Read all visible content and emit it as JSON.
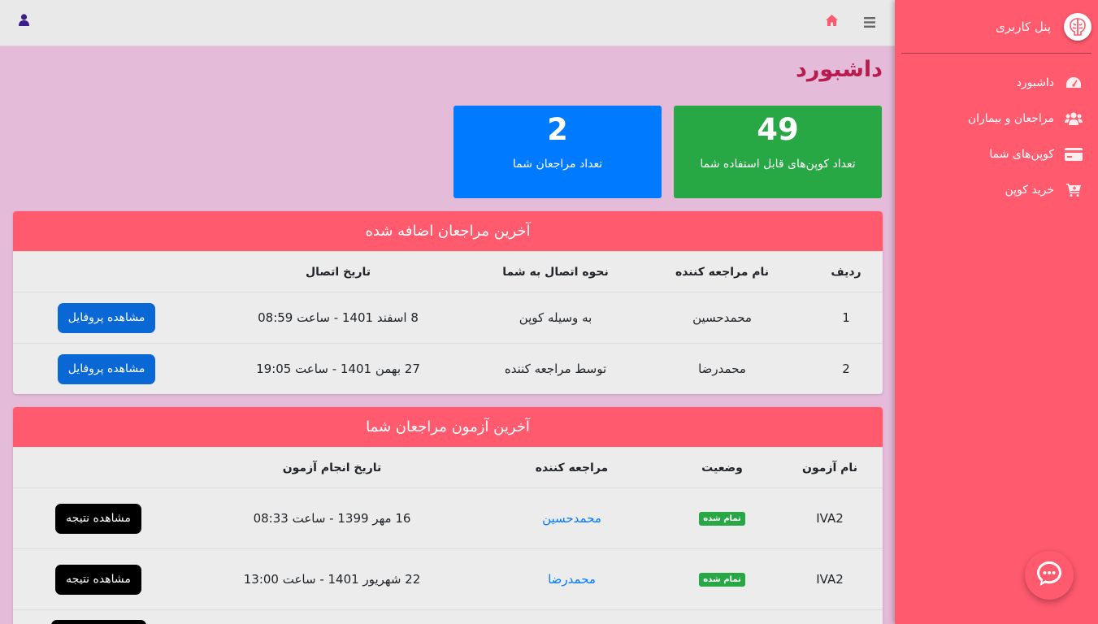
{
  "sidebar": {
    "title": "پنل کاربری",
    "items": [
      {
        "label": "داشبورد",
        "icon": "tachometer-icon"
      },
      {
        "label": "مراجعان و بیماران",
        "icon": "users-icon"
      },
      {
        "label": "کوپن‌های شما",
        "icon": "credit-card-icon"
      },
      {
        "label": "خرید کوپن",
        "icon": "cart-plus-icon"
      }
    ]
  },
  "header": {
    "icons": [
      "user-icon",
      "home-icon",
      "bars-icon"
    ]
  },
  "page": {
    "title": "داشبورد"
  },
  "stats": [
    {
      "value": "49",
      "label": "تعداد کوپن‌های قابل استفاده شما",
      "color": "#28a745"
    },
    {
      "value": "2",
      "label": "تعداد مراجعان شما",
      "color": "#007bff"
    }
  ],
  "clients_card": {
    "title": "آخرین مراجعان اضافه شده",
    "headers": [
      "ردیف",
      "نام مراجعه کننده",
      "نحوه اتصال به شما",
      "تاریخ اتصال"
    ],
    "rows": [
      {
        "index": "1",
        "name": "محمدحسین",
        "method": "به وسیله کوپن",
        "date": "8 اسفند 1401 - ساعت 08:59",
        "action": "مشاهده پروفایل"
      },
      {
        "index": "2",
        "name": "محمدرضا",
        "method": "توسط مراجعه کننده",
        "date": "27 بهمن 1401 - ساعت 19:05",
        "action": "مشاهده پروفایل"
      }
    ]
  },
  "tests_card": {
    "title": "آخرین آزمون مراجعان شما",
    "headers": [
      "نام آزمون",
      "وضعیت",
      "مراجعه کننده",
      "تاریخ انجام آزمون"
    ],
    "rows": [
      {
        "test": "IVA2",
        "status": "تمام شده",
        "client": "محمدحسین",
        "date": "16 مهر 1399 - ساعت 08:33",
        "action": "مشاهده نتیجه"
      },
      {
        "test": "IVA2",
        "status": "تمام شده",
        "client": "محمدرضا",
        "date": "22 شهریور 1401 - ساعت 13:00",
        "action": "مشاهده نتیجه"
      }
    ]
  },
  "colors": {
    "accent": "#ff5a6e",
    "title": "#b71c4f",
    "background": "#e4bbd8"
  }
}
